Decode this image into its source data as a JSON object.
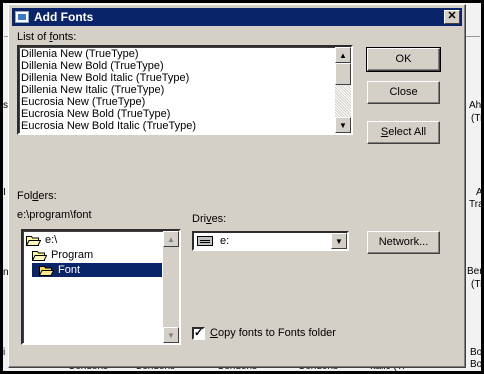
{
  "dialog": {
    "title": "Add Fonts",
    "close_symbol": "✕"
  },
  "fonts_list": {
    "label_prefix": "List of ",
    "label_underlined": "f",
    "label_suffix": "onts:",
    "items": [
      "Dillenia New (TrueType)",
      "Dillenia New Bold (TrueType)",
      "Dillenia New Bold Italic (TrueType)",
      "Dillenia New Italic (TrueType)",
      "Eucrosia New (TrueType)",
      "Eucrosia New Bold (TrueType)",
      "Eucrosia New Bold Italic (TrueType)"
    ]
  },
  "buttons": {
    "ok": "OK",
    "close": "Close",
    "select_all_underlined": "S",
    "select_all_rest": "elect All",
    "network": "Network..."
  },
  "folders": {
    "label_prefix": "Fol",
    "label_underlined": "d",
    "label_suffix": "ers:",
    "current_path": "e:\\program\\font",
    "tree": [
      "e:\\",
      "Program",
      "Font"
    ],
    "selected_index": 2
  },
  "drives": {
    "label_prefix": "Dri",
    "label_underlined": "v",
    "label_suffix": "es:",
    "value": "e:"
  },
  "copy_option": {
    "checked": true,
    "label_underlined": "C",
    "label_rest": "opy fonts to Fonts folder"
  },
  "background": {
    "right_texts": [
      "Aha",
      "(Tr",
      "A",
      "Tra",
      "Berin",
      "(Tr",
      "Bol",
      "Bol"
    ],
    "bottom_texts": [
      "Condens",
      "Condens",
      "Condens",
      "Condens",
      "Italic (Tr"
    ],
    "left_texts": [
      "s",
      "I",
      "n",
      "i"
    ]
  }
}
